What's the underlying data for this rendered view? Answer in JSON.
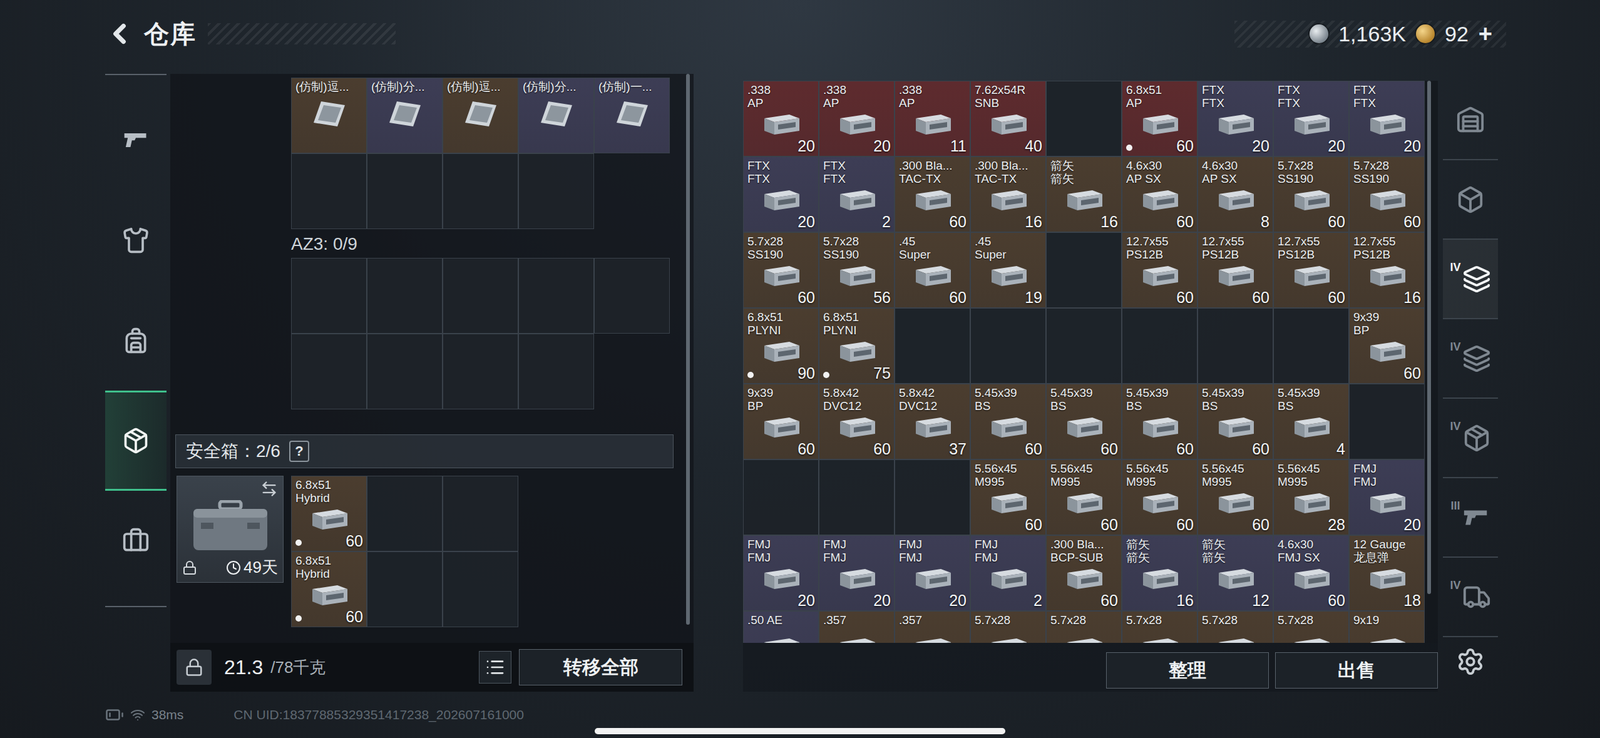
{
  "header": {
    "title": "仓库"
  },
  "currency": [
    {
      "kind": "silver",
      "amount": "1,163K"
    },
    {
      "kind": "gold",
      "amount": "92",
      "add": "+"
    }
  ],
  "nav": [
    {
      "kind": "weapon",
      "selected": false
    },
    {
      "kind": "armor",
      "selected": false
    },
    {
      "kind": "backpack",
      "selected": false
    },
    {
      "kind": "pouch",
      "selected": true
    },
    {
      "kind": "case",
      "selected": false
    }
  ],
  "top_container": {
    "rows": [
      [
        {
          "kind": "item",
          "name": "(仿制)逗...",
          "sub": "",
          "count": "",
          "color": "#4b3d2f",
          "dot": false
        },
        {
          "kind": "item",
          "name": "(仿制)分...",
          "sub": "",
          "count": "",
          "color": "#3d3d55",
          "dot": false
        },
        {
          "kind": "item",
          "name": "(仿制)逗...",
          "sub": "",
          "count": "",
          "color": "#4b3d2f",
          "dot": false
        },
        {
          "kind": "item",
          "name": "(仿制)分...",
          "sub": "",
          "count": "",
          "color": "#3d3d55",
          "dot": false
        },
        {
          "kind": "item",
          "name": "(仿制)一...",
          "sub": "",
          "count": "",
          "color": "#3d3d55",
          "dot": false
        }
      ],
      [
        {
          "kind": "empty"
        },
        {
          "kind": "empty"
        },
        {
          "kind": "empty"
        },
        {
          "kind": "empty"
        }
      ]
    ]
  },
  "az3": {
    "label": "AZ3: 0/9",
    "rows": [
      [
        {
          "kind": "empty"
        },
        {
          "kind": "empty"
        },
        {
          "kind": "empty"
        },
        {
          "kind": "empty"
        },
        {
          "kind": "empty"
        }
      ],
      [
        {
          "kind": "empty"
        },
        {
          "kind": "empty"
        },
        {
          "kind": "empty"
        },
        {
          "kind": "empty"
        }
      ]
    ]
  },
  "safe_box": {
    "label": "安全箱：2/6",
    "help": "?",
    "days": "49天",
    "locked": true,
    "rows": [
      [
        {
          "kind": "item",
          "name": "6.8x51",
          "sub": "Hybrid",
          "count": "60",
          "color": "#4b3d2f",
          "dot": true
        },
        {
          "kind": "empty"
        },
        {
          "kind": "empty"
        }
      ],
      [
        {
          "kind": "item",
          "name": "6.8x51",
          "sub": "Hybrid",
          "count": "60",
          "color": "#4b3d2f",
          "dot": true
        },
        {
          "kind": "empty"
        },
        {
          "kind": "empty"
        }
      ]
    ]
  },
  "weight": {
    "value": "21.3",
    "capacity": "/78千克"
  },
  "transfer_button": "转移全部",
  "stash": {
    "rows": [
      [
        {
          "kind": "item",
          "name": ".338",
          "sub": "AP",
          "count": "20",
          "color": "#5e2b2e",
          "dot": false
        },
        {
          "kind": "item",
          "name": ".338",
          "sub": "AP",
          "count": "20",
          "color": "#5e2b2e",
          "dot": false
        },
        {
          "kind": "item",
          "name": ".338",
          "sub": "AP",
          "count": "11",
          "color": "#5e2b2e",
          "dot": false
        },
        {
          "kind": "item",
          "name": "7.62x54R",
          "sub": "SNB",
          "count": "40",
          "color": "#5e2b2e",
          "dot": false
        },
        {
          "kind": "empty"
        },
        {
          "kind": "item",
          "name": "6.8x51",
          "sub": "AP",
          "count": "60",
          "color": "#5e2b2e",
          "dot": true
        },
        {
          "kind": "item",
          "name": "FTX",
          "sub": "FTX",
          "count": "20",
          "color": "#3d3d55",
          "dot": false
        },
        {
          "kind": "item",
          "name": "FTX",
          "sub": "FTX",
          "count": "20",
          "color": "#3d3d55",
          "dot": false
        },
        {
          "kind": "item",
          "name": "FTX",
          "sub": "FTX",
          "count": "20",
          "color": "#3d3d55",
          "dot": false
        }
      ],
      [
        {
          "kind": "item",
          "name": "FTX",
          "sub": "FTX",
          "count": "20",
          "color": "#3d3d55",
          "dot": false
        },
        {
          "kind": "item",
          "name": "FTX",
          "sub": "FTX",
          "count": "2",
          "color": "#3d3d55",
          "dot": false
        },
        {
          "kind": "item",
          "name": ".300 Bla...",
          "sub": "TAC-TX",
          "count": "60",
          "color": "#4b3d2f",
          "dot": false
        },
        {
          "kind": "item",
          "name": ".300 Bla...",
          "sub": "TAC-TX",
          "count": "16",
          "color": "#4b3d2f",
          "dot": false
        },
        {
          "kind": "item",
          "name": "箭矢",
          "sub": "箭矢",
          "count": "16",
          "color": "#4b3d2f",
          "dot": false
        },
        {
          "kind": "item",
          "name": "4.6x30",
          "sub": "AP SX",
          "count": "60",
          "color": "#4b3d2f",
          "dot": false
        },
        {
          "kind": "item",
          "name": "4.6x30",
          "sub": "AP SX",
          "count": "8",
          "color": "#4b3d2f",
          "dot": false
        },
        {
          "kind": "item",
          "name": "5.7x28",
          "sub": "SS190",
          "count": "60",
          "color": "#4b3d2f",
          "dot": false
        },
        {
          "kind": "item",
          "name": "5.7x28",
          "sub": "SS190",
          "count": "60",
          "color": "#4b3d2f",
          "dot": false
        }
      ],
      [
        {
          "kind": "item",
          "name": "5.7x28",
          "sub": "SS190",
          "count": "60",
          "color": "#4b3d2f",
          "dot": false
        },
        {
          "kind": "item",
          "name": "5.7x28",
          "sub": "SS190",
          "count": "56",
          "color": "#4b3d2f",
          "dot": false
        },
        {
          "kind": "item",
          "name": ".45",
          "sub": "Super",
          "count": "60",
          "color": "#4b3d2f",
          "dot": false
        },
        {
          "kind": "item",
          "name": ".45",
          "sub": "Super",
          "count": "19",
          "color": "#4b3d2f",
          "dot": false
        },
        {
          "kind": "empty"
        },
        {
          "kind": "item",
          "name": "12.7x55",
          "sub": "PS12B",
          "count": "60",
          "color": "#4b3d2f",
          "dot": false
        },
        {
          "kind": "item",
          "name": "12.7x55",
          "sub": "PS12B",
          "count": "60",
          "color": "#4b3d2f",
          "dot": false
        },
        {
          "kind": "item",
          "name": "12.7x55",
          "sub": "PS12B",
          "count": "60",
          "color": "#4b3d2f",
          "dot": false
        },
        {
          "kind": "item",
          "name": "12.7x55",
          "sub": "PS12B",
          "count": "16",
          "color": "#4b3d2f",
          "dot": false
        }
      ],
      [
        {
          "kind": "item",
          "name": "6.8x51",
          "sub": "PLYNI",
          "count": "90",
          "color": "#4b3d2f",
          "dot": true
        },
        {
          "kind": "item",
          "name": "6.8x51",
          "sub": "PLYNI",
          "count": "75",
          "color": "#4b3d2f",
          "dot": true
        },
        {
          "kind": "empty"
        },
        {
          "kind": "empty"
        },
        {
          "kind": "empty"
        },
        {
          "kind": "empty"
        },
        {
          "kind": "empty"
        },
        {
          "kind": "empty"
        },
        {
          "kind": "item",
          "name": "9x39",
          "sub": "BP",
          "count": "60",
          "color": "#4b3d2f",
          "dot": false
        }
      ],
      [
        {
          "kind": "item",
          "name": "9x39",
          "sub": "BP",
          "count": "60",
          "color": "#4b3d2f",
          "dot": false
        },
        {
          "kind": "item",
          "name": "5.8x42",
          "sub": "DVC12",
          "count": "60",
          "color": "#4b3d2f",
          "dot": false
        },
        {
          "kind": "item",
          "name": "5.8x42",
          "sub": "DVC12",
          "count": "37",
          "color": "#4b3d2f",
          "dot": false
        },
        {
          "kind": "item",
          "name": "5.45x39",
          "sub": "BS",
          "count": "60",
          "color": "#4b3d2f",
          "dot": false
        },
        {
          "kind": "item",
          "name": "5.45x39",
          "sub": "BS",
          "count": "60",
          "color": "#4b3d2f",
          "dot": false
        },
        {
          "kind": "item",
          "name": "5.45x39",
          "sub": "BS",
          "count": "60",
          "color": "#4b3d2f",
          "dot": false
        },
        {
          "kind": "item",
          "name": "5.45x39",
          "sub": "BS",
          "count": "60",
          "color": "#4b3d2f",
          "dot": false
        },
        {
          "kind": "item",
          "name": "5.45x39",
          "sub": "BS",
          "count": "4",
          "color": "#4b3d2f",
          "dot": false
        },
        {
          "kind": "empty"
        }
      ],
      [
        {
          "kind": "empty"
        },
        {
          "kind": "empty"
        },
        {
          "kind": "empty"
        },
        {
          "kind": "item",
          "name": "5.56x45",
          "sub": "M995",
          "count": "60",
          "color": "#4b3d2f",
          "dot": false
        },
        {
          "kind": "item",
          "name": "5.56x45",
          "sub": "M995",
          "count": "60",
          "color": "#4b3d2f",
          "dot": false
        },
        {
          "kind": "item",
          "name": "5.56x45",
          "sub": "M995",
          "count": "60",
          "color": "#4b3d2f",
          "dot": false
        },
        {
          "kind": "item",
          "name": "5.56x45",
          "sub": "M995",
          "count": "60",
          "color": "#4b3d2f",
          "dot": false
        },
        {
          "kind": "item",
          "name": "5.56x45",
          "sub": "M995",
          "count": "28",
          "color": "#4b3d2f",
          "dot": false
        },
        {
          "kind": "item",
          "name": "FMJ",
          "sub": "FMJ",
          "count": "20",
          "color": "#3d3d55",
          "dot": false
        }
      ],
      [
        {
          "kind": "item",
          "name": "FMJ",
          "sub": "FMJ",
          "count": "20",
          "color": "#3d3d55",
          "dot": false
        },
        {
          "kind": "item",
          "name": "FMJ",
          "sub": "FMJ",
          "count": "20",
          "color": "#3d3d55",
          "dot": false
        },
        {
          "kind": "item",
          "name": "FMJ",
          "sub": "FMJ",
          "count": "20",
          "color": "#3d3d55",
          "dot": false
        },
        {
          "kind": "item",
          "name": "FMJ",
          "sub": "FMJ",
          "count": "2",
          "color": "#3d3d55",
          "dot": false
        },
        {
          "kind": "item",
          "name": ".300 Bla...",
          "sub": "BCP-SUB",
          "count": "60",
          "color": "#4b3d2f",
          "dot": false
        },
        {
          "kind": "item",
          "name": "箭矢",
          "sub": "箭矢",
          "count": "16",
          "color": "#3d3d55",
          "dot": false
        },
        {
          "kind": "item",
          "name": "箭矢",
          "sub": "箭矢",
          "count": "12",
          "color": "#3d3d55",
          "dot": false
        },
        {
          "kind": "item",
          "name": "4.6x30",
          "sub": "FMJ SX",
          "count": "60",
          "color": "#3d3d55",
          "dot": false
        },
        {
          "kind": "item",
          "name": "12 Gauge",
          "sub": "龙息弹",
          "count": "18",
          "color": "#4b3d2f",
          "dot": false
        }
      ],
      [
        {
          "kind": "item",
          "name": ".50 AE",
          "sub": "",
          "count": "",
          "color": "#3d3d55",
          "dot": false
        },
        {
          "kind": "item",
          "name": ".357",
          "sub": "",
          "count": "",
          "color": "#4b3d2f",
          "dot": false
        },
        {
          "kind": "item",
          "name": ".357",
          "sub": "",
          "count": "",
          "color": "#4b3d2f",
          "dot": false
        },
        {
          "kind": "item",
          "name": "5.7x28",
          "sub": "",
          "count": "",
          "color": "#4b3d2f",
          "dot": false
        },
        {
          "kind": "item",
          "name": "5.7x28",
          "sub": "",
          "count": "",
          "color": "#4b3d2f",
          "dot": false
        },
        {
          "kind": "item",
          "name": "5.7x28",
          "sub": "",
          "count": "",
          "color": "#4b3d2f",
          "dot": false
        },
        {
          "kind": "item",
          "name": "5.7x28",
          "sub": "",
          "count": "",
          "color": "#4b3d2f",
          "dot": false
        },
        {
          "kind": "item",
          "name": "5.7x28",
          "sub": "",
          "count": "",
          "color": "#4b3d2f",
          "dot": false
        },
        {
          "kind": "item",
          "name": "9x19",
          "sub": "",
          "count": "",
          "color": "#4b3d2f",
          "dot": false
        }
      ]
    ]
  },
  "stash_buttons": [
    "整理",
    "出售"
  ],
  "side_tabs": [
    {
      "kind": "home",
      "selected": false
    },
    {
      "kind": "crate",
      "selected": false
    },
    {
      "kind": "files",
      "label": "IV",
      "selected": true
    },
    {
      "kind": "files",
      "label": "IV",
      "selected": false
    },
    {
      "kind": "medical",
      "label": "IV",
      "selected": false
    },
    {
      "kind": "weapon",
      "label": "III",
      "selected": false
    },
    {
      "kind": "vehicle",
      "label": "IV",
      "selected": false
    }
  ],
  "status": {
    "ping": "38ms",
    "uid": "CN UID:18377885329351417238_202607161000"
  }
}
